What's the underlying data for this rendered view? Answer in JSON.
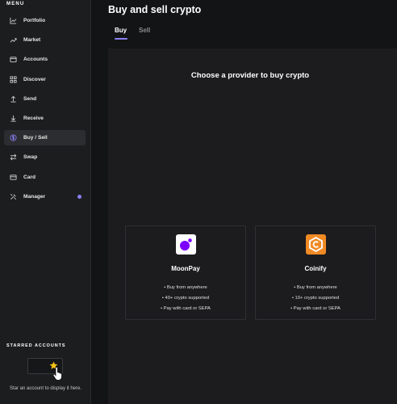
{
  "sidebar": {
    "menu_title": "MENU",
    "items": [
      {
        "label": "Portfolio",
        "icon": "chart-line-icon"
      },
      {
        "label": "Market",
        "icon": "trend-icon"
      },
      {
        "label": "Accounts",
        "icon": "wallet-icon"
      },
      {
        "label": "Discover",
        "icon": "grid-icon"
      },
      {
        "label": "Send",
        "icon": "arrow-up-icon"
      },
      {
        "label": "Receive",
        "icon": "arrow-down-icon"
      },
      {
        "label": "Buy / Sell",
        "icon": "dollar-circle-icon",
        "active": true
      },
      {
        "label": "Swap",
        "icon": "swap-icon"
      },
      {
        "label": "Card",
        "icon": "card-icon"
      },
      {
        "label": "Manager",
        "icon": "tools-icon",
        "notification": true
      }
    ],
    "starred_title": "STARRED ACCOUNTS",
    "starred_hint": "Star an account to display it here."
  },
  "main": {
    "title": "Buy and sell crypto",
    "tabs": [
      {
        "label": "Buy",
        "active": true
      },
      {
        "label": "Sell",
        "active": false
      }
    ],
    "heading": "Choose a provider to buy crypto",
    "providers": [
      {
        "name": "MoonPay",
        "logo_color": "#7d00ff",
        "features": [
          "Buy from anywhere",
          "40+ crypto supported",
          "Pay with card or SEPA"
        ]
      },
      {
        "name": "Coinify",
        "logo_color": "#f08a24",
        "features": [
          "Buy from anywhere",
          "10+ crypto supported",
          "Pay with card or SEPA"
        ]
      }
    ]
  },
  "colors": {
    "accent": "#8a80f5",
    "background": "#131415",
    "sidebar": "#1c1d1f",
    "star": "#f5c518"
  }
}
